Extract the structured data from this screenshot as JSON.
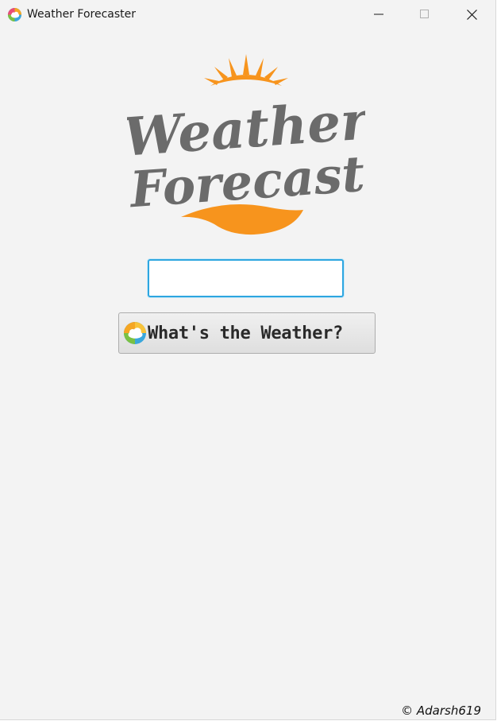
{
  "window": {
    "title": "Weather Forecaster",
    "controls": {
      "minimize": "minimize-icon",
      "maximize": "maximize-icon",
      "close": "close-icon"
    }
  },
  "logo": {
    "line1": "Weather",
    "line2": "Forecast",
    "colors": {
      "text": "#6b6b6b",
      "accent": "#f7941d"
    }
  },
  "search": {
    "value": "",
    "placeholder": ""
  },
  "action_button": {
    "label": "What's the Weather?",
    "icon": "weather-cloud-sun-icon"
  },
  "footer": {
    "copyright": "© Adarsh619"
  },
  "colors": {
    "background": "#f3f3f3",
    "input_border": "#2ea6e0"
  }
}
